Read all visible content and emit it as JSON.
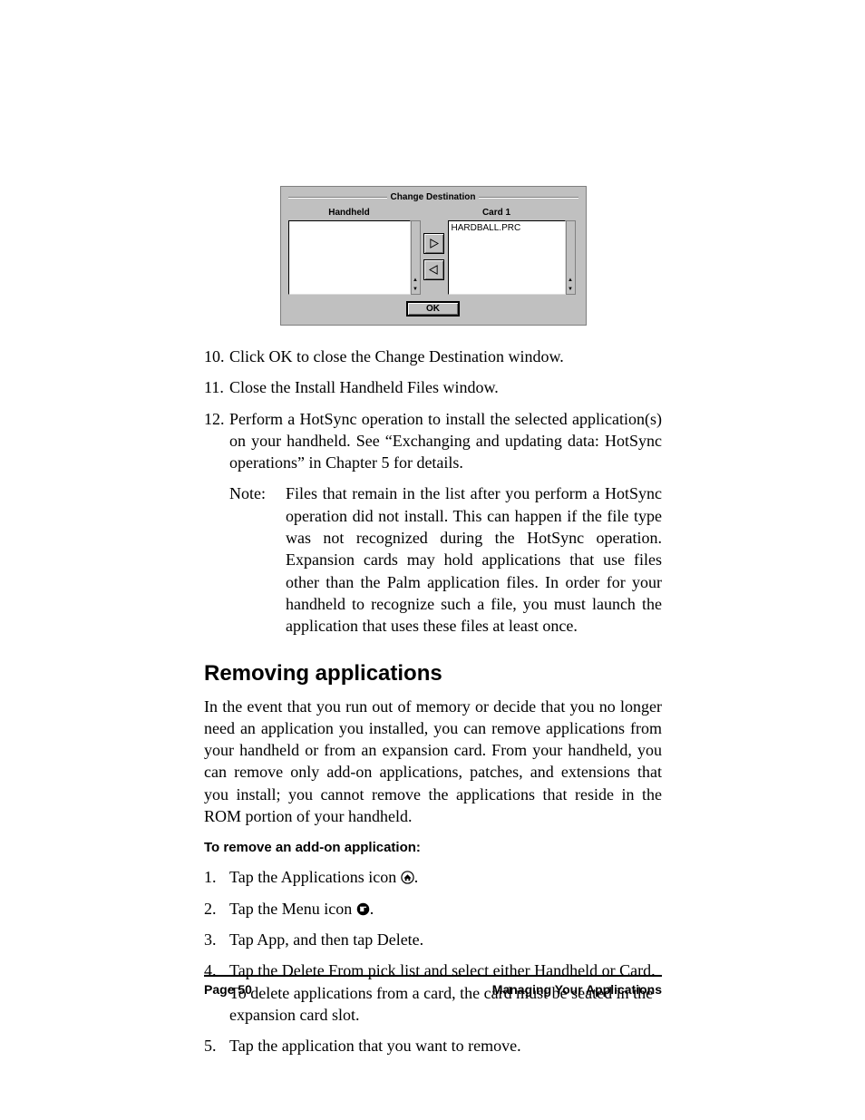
{
  "dialog": {
    "title": "Change Destination",
    "header_left": "Handheld",
    "header_right": "Card 1",
    "right_items": [
      "HARDBALL.PRC"
    ],
    "ok_label": "OK"
  },
  "continued_steps": [
    {
      "num": "10.",
      "text": "Click OK to close the Change Destination window."
    },
    {
      "num": "11.",
      "text": "Close the Install Handheld Files window."
    },
    {
      "num": "12.",
      "text": "Perform a HotSync operation to install the selected application(s) on your handheld. See “Exchanging and updating data: HotSync operations” in Chapter 5 for details."
    }
  ],
  "note": {
    "label": "Note:",
    "text": "Files that remain in the list after you perform a HotSync operation did not install. This can happen if the file type was not recognized during the HotSync operation. Expansion cards may hold applications that use files other than the Palm application files. In order for your handheld to recognize such a file, you must launch the application that uses these files at least once."
  },
  "section_heading": "Removing applications",
  "section_para": "In the event that you run out of memory or decide that you no longer need an application you installed, you can remove applications from your handheld or from an expansion card. From your handheld, you can remove only add-on applications, patches, and extensions that you install; you cannot remove the applications that reside in the ROM portion of your handheld.",
  "subhead": "To remove an add-on application:",
  "fresh_steps": [
    {
      "num": "1.",
      "pre": "Tap the Applications icon ",
      "icon": "home-icon",
      "post": "."
    },
    {
      "num": "2.",
      "pre": "Tap the Menu icon ",
      "icon": "menu-icon",
      "post": "."
    },
    {
      "num": "3.",
      "pre": "Tap App, and then tap Delete.",
      "icon": null,
      "post": ""
    },
    {
      "num": "4.",
      "pre": "Tap the Delete From pick list and select either Handheld or Card. To delete applications from a card, the card must be seated in the expansion card slot.",
      "icon": null,
      "post": ""
    },
    {
      "num": "5.",
      "pre": "Tap the application that you want to remove.",
      "icon": null,
      "post": ""
    }
  ],
  "footer": {
    "left": "Page 50",
    "right": "Managing Your Applications"
  }
}
